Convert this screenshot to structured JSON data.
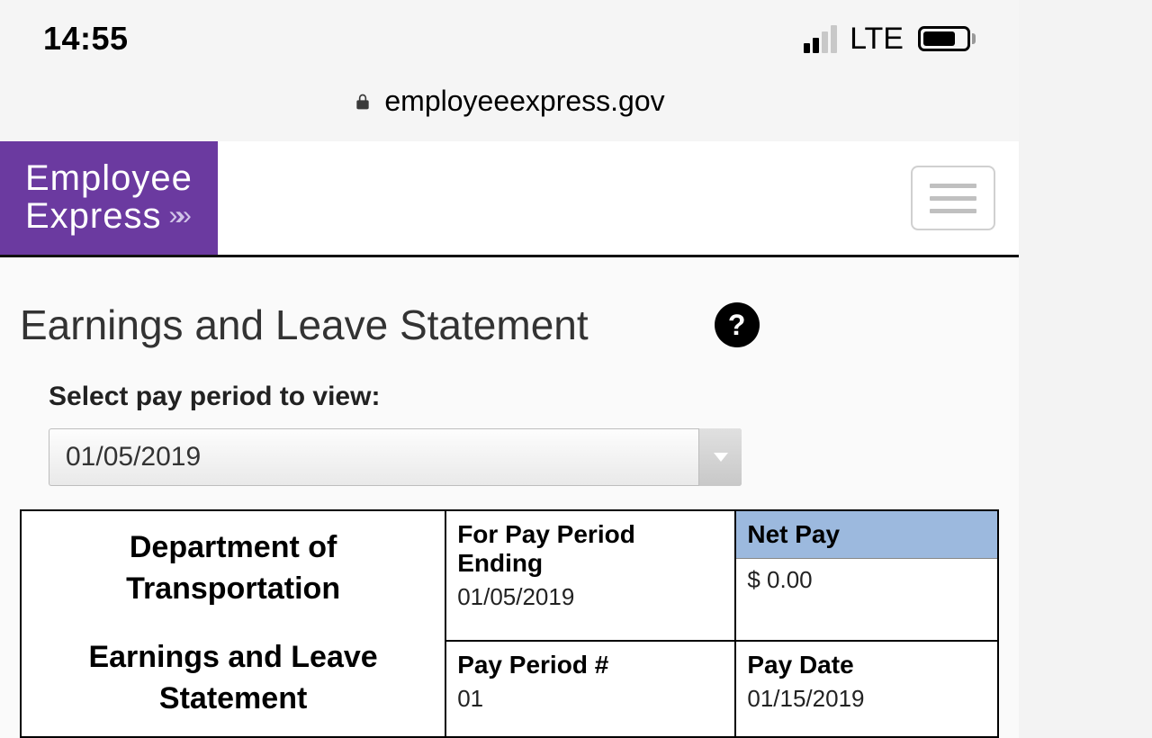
{
  "status_bar": {
    "time": "14:55",
    "network_type": "LTE"
  },
  "browser": {
    "url": "employeeexpress.gov"
  },
  "brand": {
    "line1": "Employee",
    "line2": "Express"
  },
  "page": {
    "title": "Earnings and Leave Statement",
    "select_label": "Select pay period to view:",
    "select_value": "01/05/2019"
  },
  "statement": {
    "department_line1": "Department of",
    "department_line2": "Transportation",
    "sub_title_line1": "Earnings and Leave",
    "sub_title_line2": "Statement",
    "pay_period_ending_label": "For Pay Period Ending",
    "pay_period_ending_value": "01/05/2019",
    "net_pay_label": "Net Pay",
    "net_pay_value": "$ 0.00",
    "pay_period_num_label": "Pay Period #",
    "pay_period_num_value": "01",
    "pay_date_label": "Pay Date",
    "pay_date_value": "01/15/2019"
  }
}
